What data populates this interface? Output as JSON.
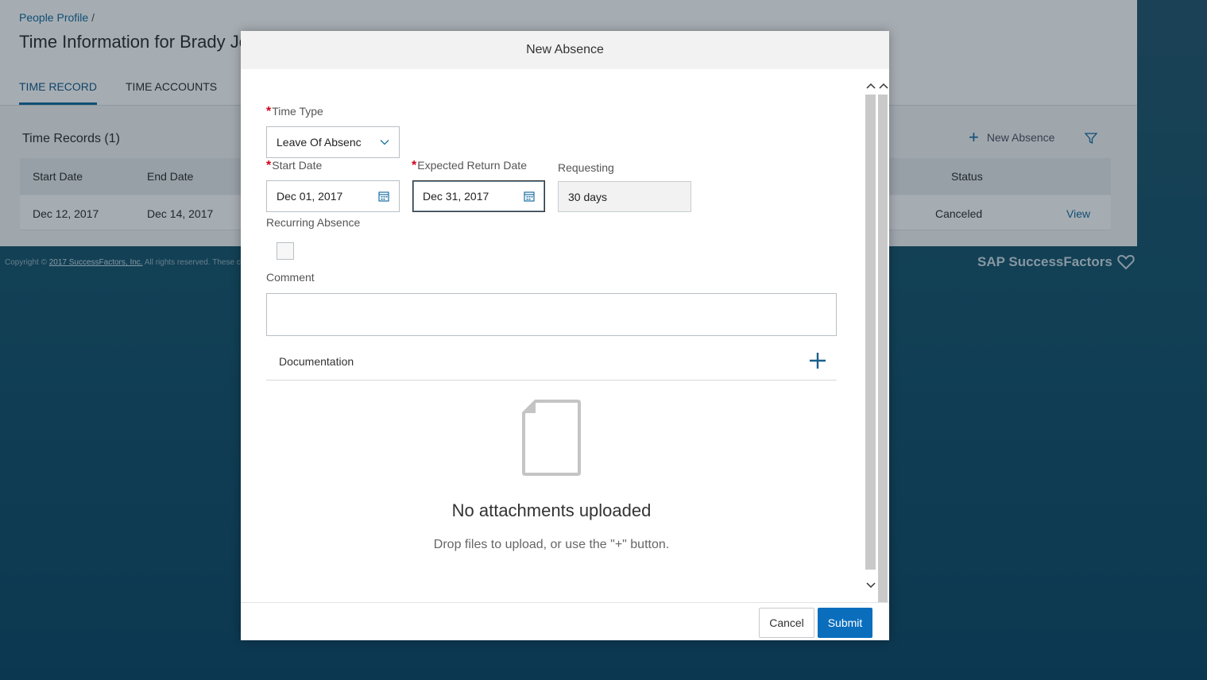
{
  "background": {
    "breadcrumb": "People Profile",
    "breadcrumb_sep": "/",
    "page_title": "Time Information for Brady Jo",
    "tabs": [
      {
        "label": "TIME RECORD",
        "active": true
      },
      {
        "label": "TIME ACCOUNTS",
        "active": false
      }
    ],
    "records_title": "Time Records (1)",
    "new_absence_label": "New Absence",
    "columns": [
      "Start Date",
      "End Date",
      "Status"
    ],
    "rows": [
      {
        "start": "Dec 12, 2017",
        "end": "Dec 14, 2017",
        "status": "Canceled",
        "action": "View"
      }
    ],
    "footer_copy_prefix": "Copyright ©",
    "footer_copy_link": "2017 SuccessFactors, Inc.",
    "footer_copy_suffix": "All rights reserved. These c",
    "brand": "SAP SuccessFactors"
  },
  "dialog": {
    "title": "New Absence",
    "required_mark": "*",
    "time_type": {
      "label": "Time Type",
      "value": "Leave Of Absenc"
    },
    "start_date": {
      "label": "Start Date",
      "value": "Dec 01, 2017"
    },
    "return_date": {
      "label": "Expected Return Date",
      "value": "Dec 31, 2017"
    },
    "requesting": {
      "label": "Requesting",
      "value": "30 days"
    },
    "recurring": {
      "label": "Recurring Absence",
      "checked": false
    },
    "comment": {
      "label": "Comment",
      "value": ""
    },
    "documentation": {
      "label": "Documentation"
    },
    "empty_title": "No attachments uploaded",
    "empty_sub": "Drop files to upload, or use the \"+\" button.",
    "cancel_label": "Cancel",
    "submit_label": "Submit"
  },
  "colors": {
    "accent": "#0a6ebd",
    "link": "#1a6fa3",
    "required": "#d0021b"
  },
  "icons": [
    "chevron-down-icon",
    "calendar-icon",
    "plus-icon",
    "file-icon",
    "filter-icon",
    "heart-icon",
    "scroll-up-arrow-icon",
    "scroll-down-arrow-icon"
  ]
}
